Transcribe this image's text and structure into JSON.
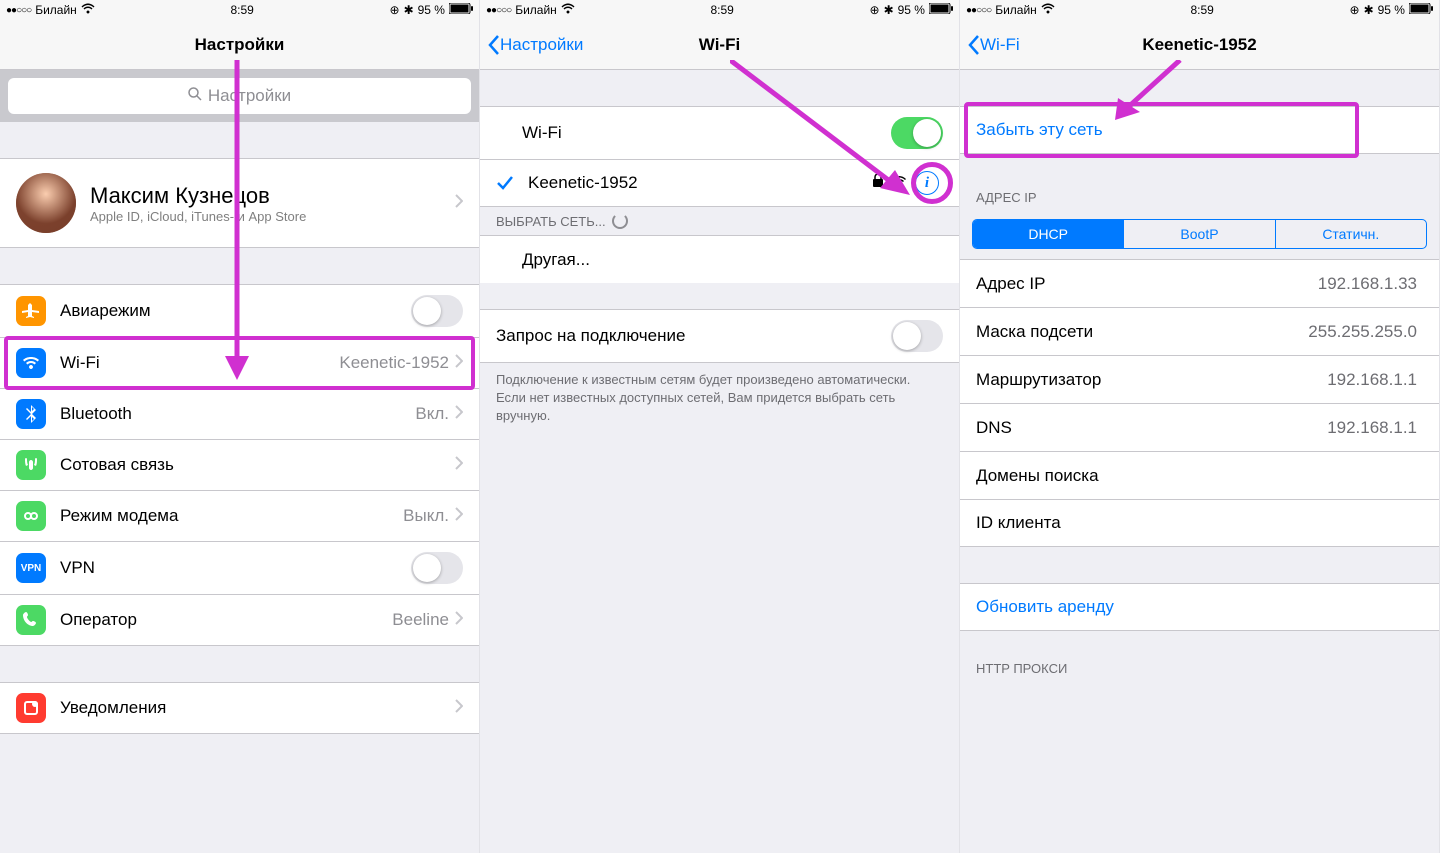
{
  "statusbar": {
    "carrier": "Билайн",
    "time": "8:59",
    "battery": "95 %"
  },
  "screen1": {
    "title": "Настройки",
    "search_placeholder": "Настройки",
    "profile": {
      "name": "Максим Кузнецов",
      "sub": "Apple ID, iCloud, iTunes- и App Store"
    },
    "rows": {
      "airplane": "Авиарежим",
      "wifi": "Wi-Fi",
      "wifi_value": "Keenetic-1952",
      "bluetooth": "Bluetooth",
      "bluetooth_value": "Вкл.",
      "cellular": "Сотовая связь",
      "hotspot": "Режим модема",
      "hotspot_value": "Выкл.",
      "vpn": "VPN",
      "vpn_text": "VPN",
      "carrier": "Оператор",
      "carrier_value": "Beeline",
      "notifications": "Уведомления"
    }
  },
  "screen2": {
    "back": "Настройки",
    "title": "Wi-Fi",
    "wifi_label": "Wi-Fi",
    "connected": "Keenetic-1952",
    "choose_network": "ВЫБРАТЬ СЕТЬ...",
    "other": "Другая...",
    "ask_join": "Запрос на подключение",
    "footer": "Подключение к известным сетям будет произведено автоматически. Если нет известных доступных сетей, Вам придется выбрать сеть вручную."
  },
  "screen3": {
    "back": "Wi-Fi",
    "title": "Keenetic-1952",
    "forget": "Забыть эту сеть",
    "ip_header": "АДРЕС IP",
    "seg": {
      "dhcp": "DHCP",
      "bootp": "BootP",
      "static": "Статичн."
    },
    "ip": {
      "label": "Адрес IP",
      "value": "192.168.1.33"
    },
    "mask": {
      "label": "Маска подсети",
      "value": "255.255.255.0"
    },
    "router": {
      "label": "Маршрутизатор",
      "value": "192.168.1.1"
    },
    "dns": {
      "label": "DNS",
      "value": "192.168.1.1"
    },
    "search_domains": "Домены поиска",
    "client_id": "ID клиента",
    "renew": "Обновить аренду",
    "http_proxy": "HTTP ПРОКСИ"
  }
}
